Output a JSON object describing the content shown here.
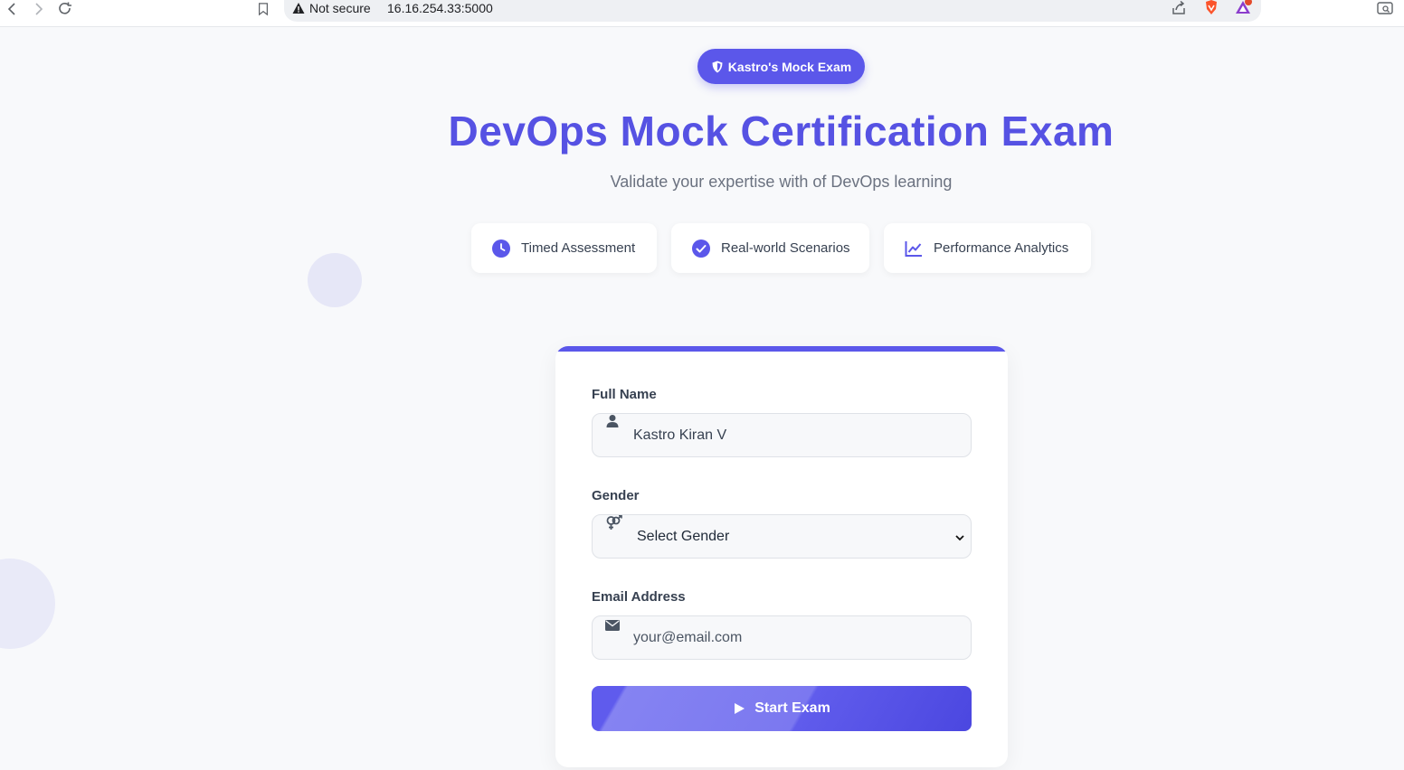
{
  "browser": {
    "security_label": "Not secure",
    "url": "16.16.254.33:5000"
  },
  "badge": {
    "label": "Kastro's Mock Exam",
    "icon": "shield-icon"
  },
  "hero": {
    "title": "DevOps Mock Certification Exam",
    "subtitle": "Validate your expertise with of DevOps learning"
  },
  "features": [
    {
      "label": "Timed Assessment",
      "icon": "clock-icon"
    },
    {
      "label": "Real-world Scenarios",
      "icon": "check-circle-icon"
    },
    {
      "label": "Performance Analytics",
      "icon": "chart-line-icon"
    }
  ],
  "form": {
    "name_label": "Full Name",
    "name_value": "Kastro Kiran V",
    "gender_label": "Gender",
    "gender_value": "Select Gender",
    "email_label": "Email Address",
    "email_placeholder": "your@email.com",
    "submit_label": "Start Exam"
  },
  "colors": {
    "accent": "#5b57ea",
    "title": "#5652e3",
    "background": "#f8f9fb"
  }
}
